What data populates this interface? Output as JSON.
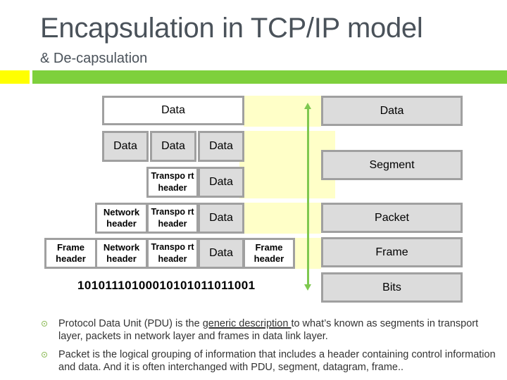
{
  "title": "Encapsulation in TCP/IP model",
  "subtitle": "& De-capsulation",
  "diagram": {
    "application_row": {
      "data": "Data"
    },
    "segment_split_row": [
      "Data",
      "Data",
      "Data"
    ],
    "transport_row": {
      "header": "Transpo rt header",
      "data": "Data"
    },
    "network_row": {
      "network_header": "Network header",
      "transport_header": "Transpo rt header",
      "data": "Data"
    },
    "frame_row": {
      "frame_header": "Frame header",
      "network_header": "Network header",
      "transport_header": "Transpo rt header",
      "data": "Data",
      "frame_trailer": "Frame header"
    },
    "bits": "10101110100010101011011001",
    "pdu_labels": [
      "Data",
      "Segment",
      "Packet",
      "Frame",
      "Bits"
    ],
    "arrow_color": "#7ec850"
  },
  "bullets": [
    {
      "pre": "Protocol Data Unit (PDU) is the ",
      "underlined": "generic description ",
      "post": "to what’s known as segments in transport layer, packets in network layer and frames in data link layer."
    },
    {
      "text": "Packet is the logical grouping of information that includes a header containing control information and data. And it is often interchanged with PDU, segment, datagram, frame.."
    }
  ],
  "colors": {
    "title": "#4a525a",
    "accent_green": "#7ed03c",
    "accent_yellow": "#ffff00",
    "highlight": "#ffffc8",
    "box_fill": "#dcdcdc",
    "box_border": "#a0a0a0"
  }
}
